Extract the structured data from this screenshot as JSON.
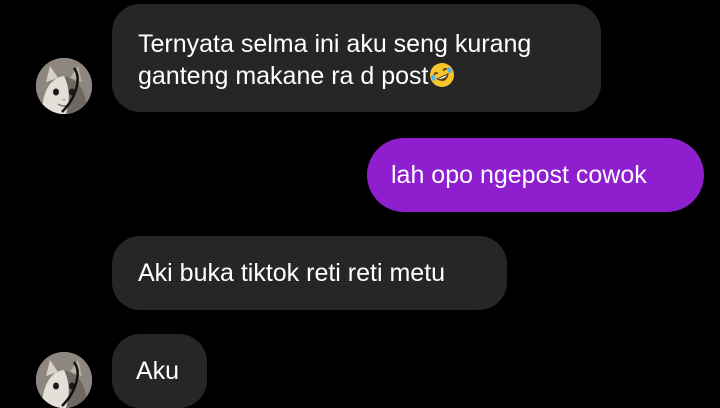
{
  "conversation": {
    "messages": [
      {
        "direction": "incoming",
        "text": "Ternyata selma ini aku seng kurang ganteng makane ra d post",
        "emoji": "rolling-on-floor-laughing"
      },
      {
        "direction": "outgoing",
        "text": "lah opo ngepost cowok"
      },
      {
        "direction": "incoming",
        "text": "Aki buka tiktok reti reti metu"
      },
      {
        "direction": "incoming",
        "text": "Aku"
      }
    ],
    "avatar": {
      "icon": "cat-avatar",
      "description_colors": {
        "fur": "#cfcac3",
        "patch": "#7a736b"
      }
    }
  },
  "colors": {
    "background": "#000000",
    "incoming_bubble": "#262626",
    "outgoing_bubble": "#8f1fce",
    "text": "#ffffff"
  }
}
